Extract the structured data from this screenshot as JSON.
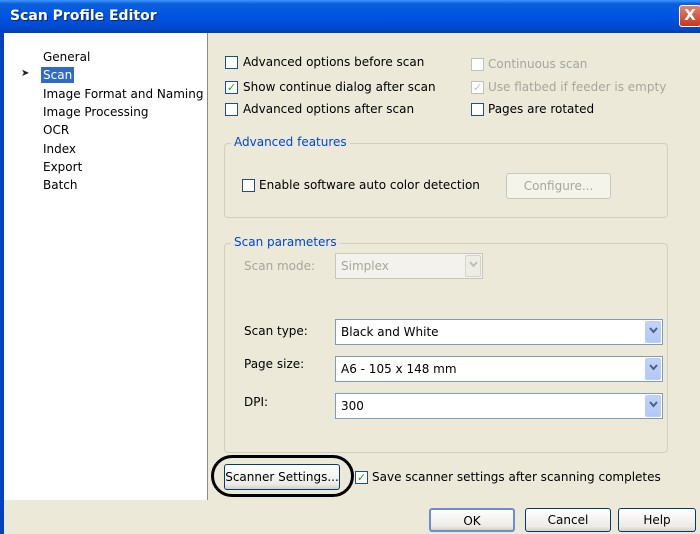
{
  "window": {
    "title": "Scan Profile Editor",
    "close_symbol": "X"
  },
  "tree": {
    "items": [
      {
        "label": "General"
      },
      {
        "label": "Scan"
      },
      {
        "label": "Image Format and Naming"
      },
      {
        "label": "Image Processing"
      },
      {
        "label": "OCR"
      },
      {
        "label": "Index"
      },
      {
        "label": "Export"
      },
      {
        "label": "Batch"
      }
    ],
    "selected": "Scan"
  },
  "options": {
    "advanced_before": {
      "label": "Advanced options before scan",
      "checked": false
    },
    "show_continue": {
      "label": "Show continue dialog after scan",
      "checked": true
    },
    "advanced_after": {
      "label": "Advanced options after scan",
      "checked": false
    },
    "continuous": {
      "label": "Continuous scan",
      "checked": false,
      "disabled": true
    },
    "use_flatbed": {
      "label": "Use flatbed if feeder is empty",
      "checked": true,
      "disabled": true
    },
    "pages_rotated": {
      "label": "Pages are rotated",
      "checked": false
    }
  },
  "advanced_features": {
    "title": "Advanced features",
    "auto_color": {
      "label": "Enable software auto color detection",
      "checked": false
    },
    "configure_label": "Configure..."
  },
  "scan_parameters": {
    "title": "Scan parameters",
    "scan_mode": {
      "label": "Scan mode:",
      "value": "Simplex",
      "disabled": true
    },
    "scan_type": {
      "label": "Scan type:",
      "value": "Black and White"
    },
    "page_size": {
      "label": "Page size:",
      "value": "A6 - 105 x 148 mm"
    },
    "dpi": {
      "label": "DPI:",
      "value": "300"
    }
  },
  "scanner": {
    "settings_button": "Scanner Settings...",
    "save_settings": {
      "label": "Save scanner settings after scanning completes",
      "checked": true
    }
  },
  "footer": {
    "ok": "OK",
    "cancel": "Cancel",
    "help": "Help"
  },
  "icons": {
    "check": "checkmark-icon",
    "arrow": "arrow-right-icon",
    "dropdown": "chevron-down-icon"
  },
  "colors": {
    "titlebar": "#0054e3",
    "selection": "#316ac5",
    "group_title": "#0046d5"
  }
}
